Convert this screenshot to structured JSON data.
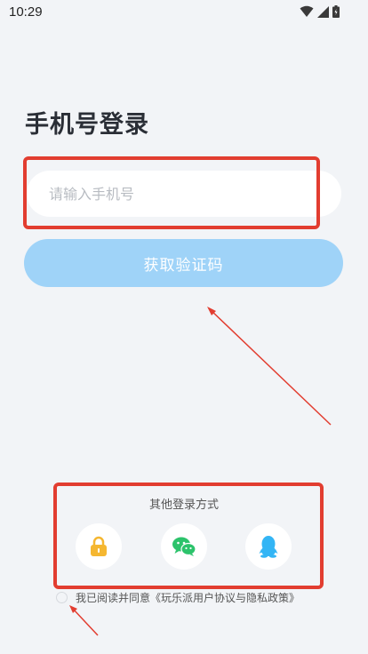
{
  "status_bar": {
    "time": "10:29",
    "icons": [
      "wifi-icon",
      "signal-icon",
      "battery-icon"
    ]
  },
  "login": {
    "title": "手机号登录",
    "phone_placeholder": "请输入手机号",
    "phone_value": "",
    "get_code_label": "获取验证码"
  },
  "other_login": {
    "title": "其他登录方式",
    "methods": [
      {
        "name": "lock-icon",
        "color": "#f5b731"
      },
      {
        "name": "wechat-icon",
        "color": "#2cc36b"
      },
      {
        "name": "qq-icon",
        "color": "#33b5f5"
      }
    ]
  },
  "agreement": {
    "text": "我已阅读并同意《玩乐派用户协议与隐私政策》",
    "checked": false
  },
  "colors": {
    "background": "#f2f4f7",
    "primary_button": "#9fd3f8",
    "annotation": "#e23d30"
  }
}
